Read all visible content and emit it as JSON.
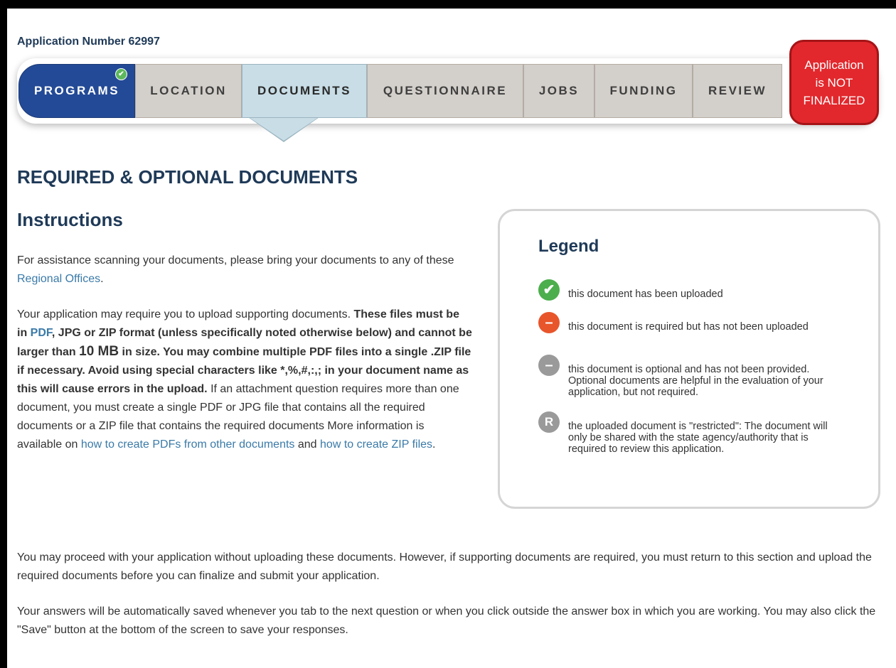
{
  "application_number": "Application Number 62997",
  "tabs": [
    {
      "label": "PROGRAMS",
      "state": "completed"
    },
    {
      "label": "LOCATION",
      "state": "default"
    },
    {
      "label": "DOCUMENTS",
      "state": "current"
    },
    {
      "label": "QUESTIONNAIRE",
      "state": "default"
    },
    {
      "label": "JOBS",
      "state": "default"
    },
    {
      "label": "FUNDING",
      "state": "default"
    },
    {
      "label": "REVIEW",
      "state": "default"
    }
  ],
  "status_badge": {
    "line1": "Application",
    "line2": "is NOT",
    "line3": "FINALIZED"
  },
  "page_title": "REQUIRED & OPTIONAL DOCUMENTS",
  "instructions_title": "Instructions",
  "p1": {
    "pre": "For assistance scanning your documents, please bring your documents to any of these ",
    "link": "Regional Offices",
    "post": "."
  },
  "p2": {
    "t1": "Your application may require you to upload supporting documents. ",
    "b1": "These files must be in ",
    "pdf_link": "PDF",
    "b2": ", JPG or ZIP format (unless specifically noted otherwise below) and cannot be larger than ",
    "size": "10 MB",
    "b3": " in size. You may combine multiple PDF files into a single .ZIP file if necessary. Avoid using special characters like *,%,#,:,; in your document name as this will cause errors in the upload.",
    "t2": " If an attachment question requires more than one document, you must create a single PDF or JPG file that contains all the required documents or a ZIP file that contains the required documents More information is available on ",
    "link1": "how to create PDFs from other documents",
    "and": " and ",
    "link2": "how to create ZIP files",
    "end": "."
  },
  "p3": "You may proceed with your application without uploading these documents. However, if supporting documents are required, you must return to this section and upload the required documents before you can finalize and submit your application.",
  "p4": "Your answers will be automatically saved whenever you tab to the next question or when you click outside the answer box in which you are working. You may also click the \"Save\" button at the bottom of the screen to save your responses.",
  "legend": {
    "title": "Legend",
    "items": [
      {
        "icon": "check-circle-icon",
        "glyph": "✔",
        "color": "#4cae4c",
        "text": "this document has been uploaded"
      },
      {
        "icon": "minus-circle-red-icon",
        "glyph": "–",
        "color": "#e8552b",
        "text": "this document is required but has not been uploaded"
      },
      {
        "icon": "minus-circle-gray-icon",
        "glyph": "–",
        "color": "#9a9a9a",
        "text": "this document is optional and has not been provided. Optional documents are helpful in the evaluation of your application, but not required."
      },
      {
        "icon": "restricted-r-icon",
        "glyph": "R",
        "color": "#9a9a9a",
        "text": "the uploaded document is \"restricted\": The document will only be shared with the state agency/authority that is required to review this application."
      }
    ]
  }
}
